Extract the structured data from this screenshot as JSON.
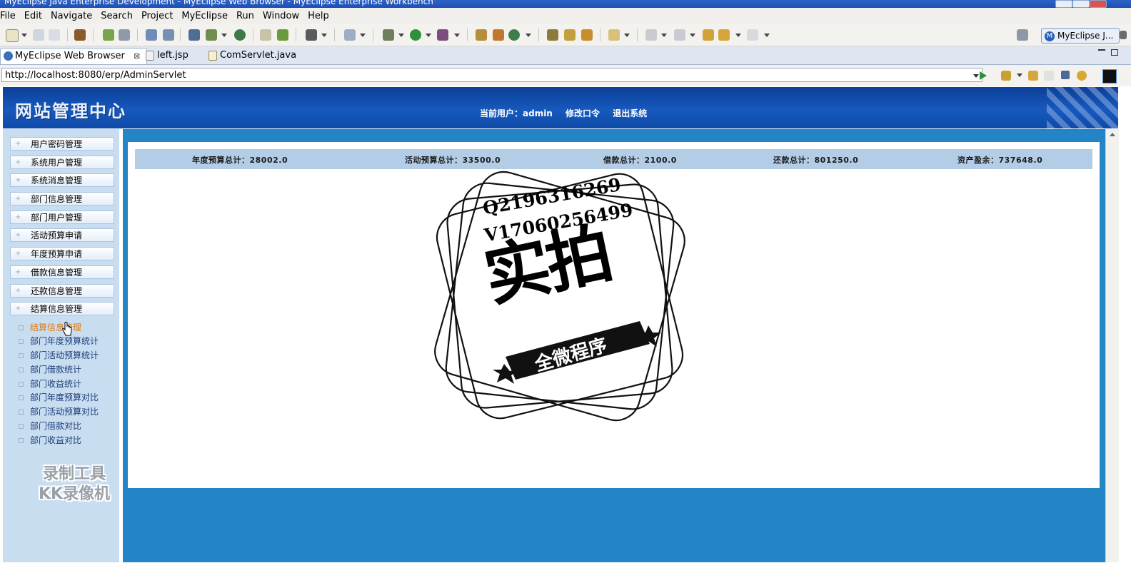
{
  "window": {
    "title": "MyEclipse Java Enterprise Development - MyEclipse Web Browser - MyEclipse Enterprise Workbench"
  },
  "menubar": {
    "items": [
      "File",
      "Edit",
      "Navigate",
      "Search",
      "Project",
      "MyEclipse",
      "Run",
      "Window",
      "Help"
    ]
  },
  "toolbar": {
    "perspective_label": "MyEclipse J...",
    "perspective_icon_letter": "M"
  },
  "tabs": [
    {
      "label": "MyEclipse Web Browser",
      "close": "⊠"
    },
    {
      "label": "left.jsp"
    },
    {
      "label": "ComServlet.java"
    }
  ],
  "address": {
    "url": "http://localhost:8080/erp/AdminServlet"
  },
  "header": {
    "site_title": "网站管理中心",
    "current_user": "当前用户：admin",
    "change_password": "修改口令",
    "logout": "退出系统"
  },
  "sidebar": {
    "items": [
      "用户密码管理",
      "系统用户管理",
      "系统消息管理",
      "部门信息管理",
      "部门用户管理",
      "活动预算申请",
      "年度预算申请",
      "借款信息管理",
      "还款信息管理",
      "结算信息管理"
    ],
    "sub_items": [
      "结算信息管理",
      "部门年度预算统计",
      "部门活动预算统计",
      "部门借款统计",
      "部门收益统计",
      "部门年度预算对比",
      "部门活动预算对比",
      "部门借款对比",
      "部门收益对比"
    ],
    "watermark_line1": "录制工具",
    "watermark_line2": "KK录像机"
  },
  "stats": {
    "annual_budget": "年度预算总计：28002.0",
    "activity_budget": "活动预算总计：33500.0",
    "loan_total": "借款总计：2100.0",
    "repay_total": "还款总计：801250.0",
    "asset_surplus": "资产盈余：737648.0"
  },
  "stamp": {
    "line1": "Q2196316269",
    "line2": "V17060256499",
    "big": "实拍",
    "banner": "全微程序"
  }
}
